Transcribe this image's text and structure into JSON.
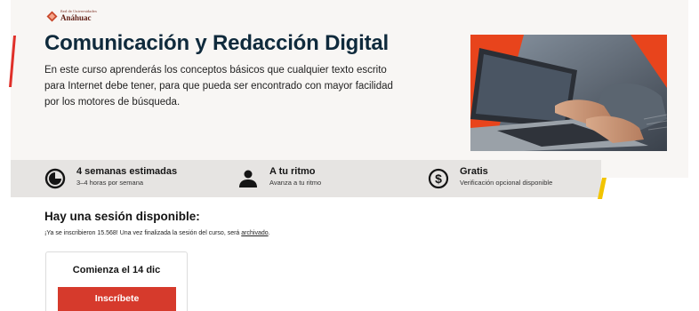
{
  "logo": {
    "small_text": "Red de Universidades",
    "brand_text": "Anáhuac"
  },
  "course": {
    "title": "Comunicación y Redacción Digital",
    "description": "En este curso aprenderás los conceptos básicos que cualquier texto escrito para Internet debe tener, para que pueda ser encontrado con mayor facilidad por los motores de búsqueda."
  },
  "stats": [
    {
      "title": "4 semanas estimadas",
      "subtitle": "3–4 horas por semana",
      "icon": "clock-icon"
    },
    {
      "title": "A tu ritmo",
      "subtitle": "Avanza a tu ritmo",
      "icon": "person-icon"
    },
    {
      "title": "Gratis",
      "subtitle": "Verificación opcional disponible",
      "icon": "dollar-icon"
    }
  ],
  "session": {
    "heading": "Hay una sesión disponible:",
    "note_prefix": "¡Ya se inscribieron 15.568! Una vez finalizada la sesión del curso, será ",
    "note_link": "archivado",
    "note_suffix": ".",
    "card_title": "Comienza el 14 dic",
    "enroll_label": "Inscríbete"
  },
  "colors": {
    "accent_red": "#d63a2c",
    "accent_orange": "#e8441c",
    "accent_yellow": "#f2c400",
    "title_navy": "#0f2a3c",
    "logo_brown": "#5e1c12"
  }
}
